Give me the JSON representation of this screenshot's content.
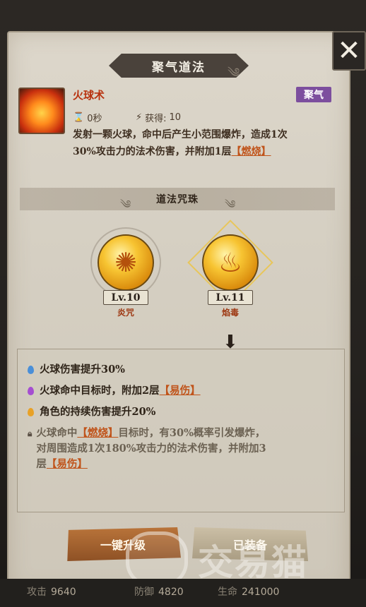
{
  "dialog": {
    "title": "聚气道法",
    "close_icon": "close-icon"
  },
  "skill": {
    "name": "火球术",
    "tag": "聚气",
    "tag_color": "#7c4e9e",
    "cooldown": "0秒",
    "gain_label": "获得:",
    "gain_value": "10",
    "desc_line1": "发射一颗火球，命中后产生小范围爆炸，造成1次",
    "desc_line2_prefix": "30%攻击力的法术伤害，并附加1层",
    "desc_burn": "【燃烧】"
  },
  "section": {
    "title": "道法咒珠"
  },
  "orbs": [
    {
      "level": "Lv.10",
      "name": "炎咒",
      "selected": false
    },
    {
      "level": "Lv.11",
      "name": "焰毒",
      "selected": true
    }
  ],
  "effects": {
    "e1": "火球伤害提升30%",
    "e2_prefix": "火球命中目标时，附加2层",
    "e2_tag": "【易伤】",
    "e3": "角色的持续伤害提升20%",
    "e4_prefix": "火球命中",
    "e4_tag": "【燃烧】",
    "e4_line1_suffix": "目标时，有30%概率引发爆炸，",
    "e4_line2": "对周围造成1次180%攻击力的法术伤害，并附加3",
    "e4_line3_prefix": "层",
    "e4_line3_tag": "【易伤】"
  },
  "buttons": {
    "upgrade": "一键升级",
    "equipped": "已装备"
  },
  "stats": {
    "atk_label": "攻击",
    "atk_value": "9640",
    "def_label": "防御",
    "def_value": "4820",
    "hp_label": "生命",
    "hp_value": "241000"
  },
  "watermark": {
    "text": "交易猫"
  }
}
